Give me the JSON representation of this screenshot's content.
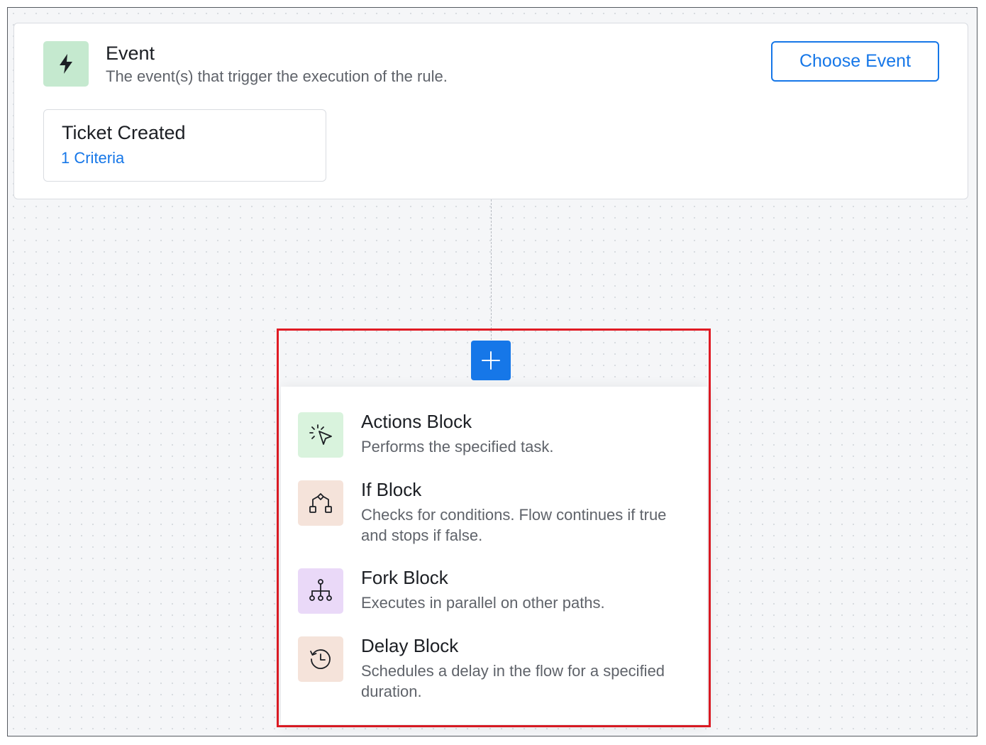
{
  "event": {
    "title": "Event",
    "subtitle": "The event(s) that trigger the execution of the rule.",
    "choose_button": "Choose Event",
    "icon": "lightning-bolt-icon",
    "icon_bg": "#c5e9cf"
  },
  "trigger": {
    "name": "Ticket Created",
    "criteria": "1 Criteria"
  },
  "add_button": {
    "icon": "plus-icon",
    "color": "#1677e8"
  },
  "menu": {
    "items": [
      {
        "title": "Actions Block",
        "description": "Performs the specified task.",
        "icon": "cursor-click-icon",
        "icon_bg": "#d9f3dd"
      },
      {
        "title": "If Block",
        "description": "Checks for conditions. Flow continues if true and stops if false.",
        "icon": "condition-branch-icon",
        "icon_bg": "#f5e3da"
      },
      {
        "title": "Fork Block",
        "description": "Executes in parallel on other paths.",
        "icon": "fork-tree-icon",
        "icon_bg": "#ead9f8"
      },
      {
        "title": "Delay Block",
        "description": "Schedules a delay in the flow for a specified duration.",
        "icon": "clock-history-icon",
        "icon_bg": "#f5e3da"
      }
    ]
  },
  "colors": {
    "accent": "#1677e8",
    "highlight_border": "#e01b24"
  }
}
